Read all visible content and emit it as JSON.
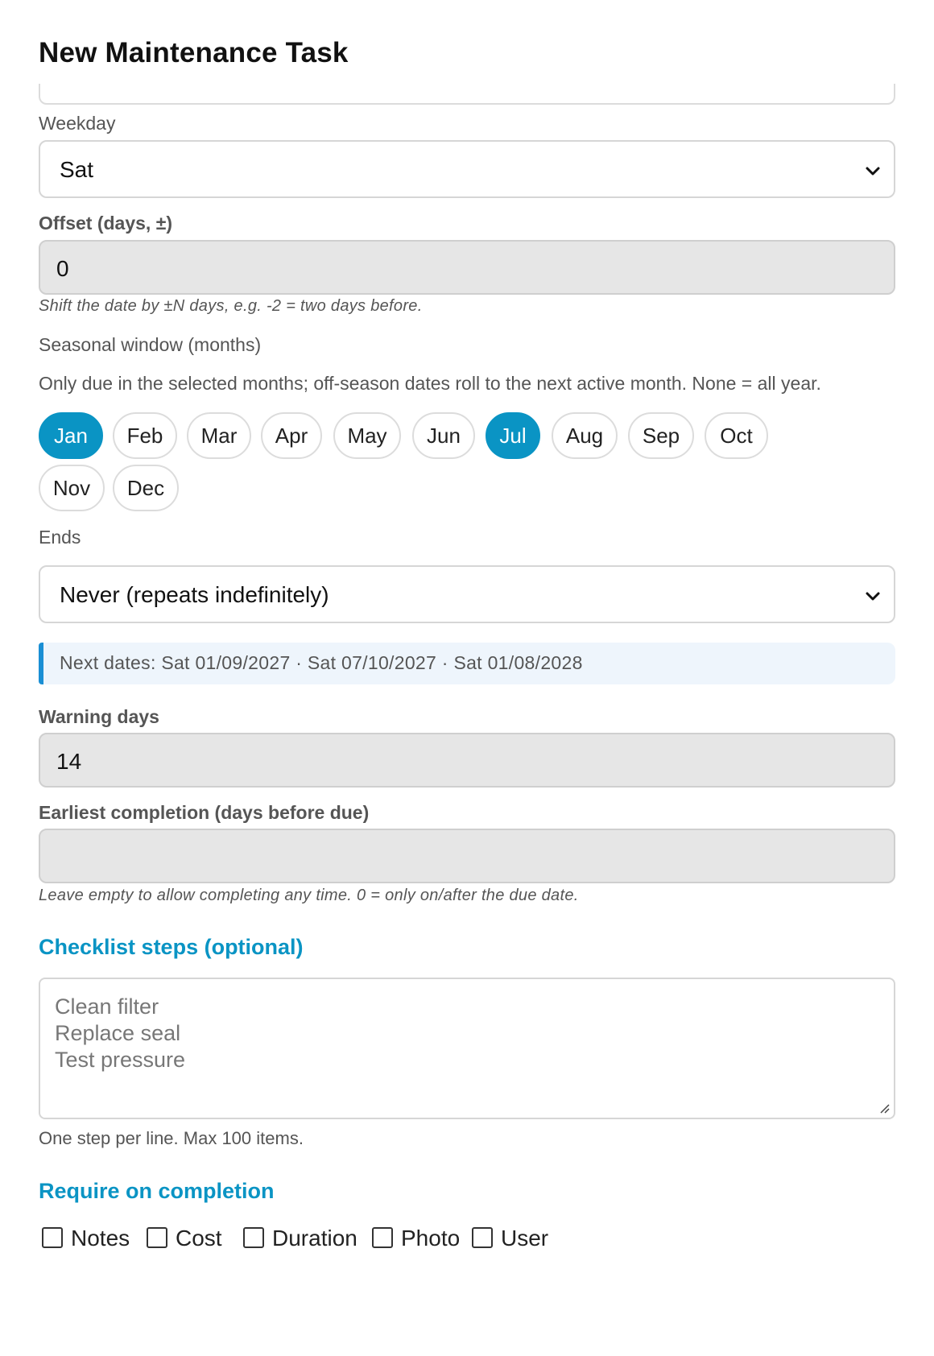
{
  "header": {
    "title": "New Maintenance Task"
  },
  "weekday": {
    "label": "Weekday",
    "value": "Sat"
  },
  "offset": {
    "label": "Offset (days, ±)",
    "value": "0",
    "hint": "Shift the date by ±N days, e.g. -2 = two days before."
  },
  "seasonal": {
    "label": "Seasonal window (months)",
    "description": "Only due in the selected months; off-season dates roll to the next active month. None = all year.",
    "months": [
      {
        "label": "Jan",
        "selected": true
      },
      {
        "label": "Feb",
        "selected": false
      },
      {
        "label": "Mar",
        "selected": false
      },
      {
        "label": "Apr",
        "selected": false
      },
      {
        "label": "May",
        "selected": false
      },
      {
        "label": "Jun",
        "selected": false
      },
      {
        "label": "Jul",
        "selected": true
      },
      {
        "label": "Aug",
        "selected": false
      },
      {
        "label": "Sep",
        "selected": false
      },
      {
        "label": "Oct",
        "selected": false
      },
      {
        "label": "Nov",
        "selected": false
      },
      {
        "label": "Dec",
        "selected": false
      }
    ]
  },
  "ends": {
    "label": "Ends",
    "value": "Never (repeats indefinitely)"
  },
  "next_dates": {
    "text": "Next dates: Sat 01/09/2027 · Sat 07/10/2027 · Sat 01/08/2028"
  },
  "warning_days": {
    "label": "Warning days",
    "value": "14"
  },
  "earliest_completion": {
    "label": "Earliest completion (days before due)",
    "value": "",
    "hint": "Leave empty to allow completing any time. 0 = only on/after the due date."
  },
  "checklist": {
    "heading": "Checklist steps (optional)",
    "placeholder_lines": [
      "Clean filter",
      "Replace seal",
      "Test pressure"
    ],
    "hint": "One step per line. Max 100 items."
  },
  "require": {
    "heading": "Require on completion",
    "options": [
      {
        "label": "Notes",
        "checked": false
      },
      {
        "label": "Cost",
        "checked": false
      },
      {
        "label": "Duration",
        "checked": false
      },
      {
        "label": "Photo",
        "checked": false
      },
      {
        "label": "User",
        "checked": false
      }
    ]
  },
  "colors": {
    "accent": "#0a94c4",
    "info_border": "#1a8fd4",
    "info_bg": "#eef5fc",
    "input_grey": "#e6e6e6"
  }
}
